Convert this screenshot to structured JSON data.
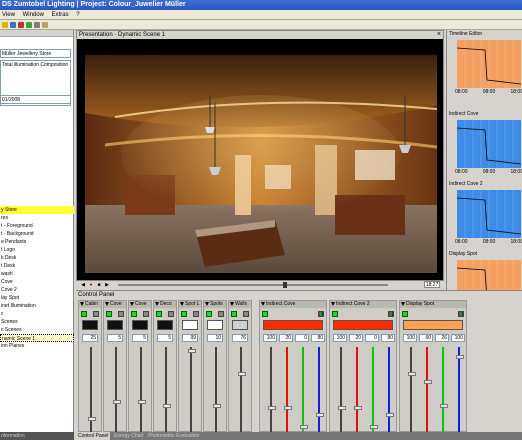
{
  "window": {
    "title": "DS Zumtobel Lighting | Project: Colour_Juwelier Müller"
  },
  "menu": [
    "View",
    "Window",
    "Extras",
    "?"
  ],
  "left_panel": {
    "store_field": "Müller Jewellery Store",
    "composition_field": "Total illumination Composition",
    "date_field": "01/2008",
    "tree_items": [
      "y Store",
      "res",
      "t - Foreground",
      "t - Background",
      "e Pendants",
      "t Logo",
      "k Desk",
      "t Desk",
      "wash",
      "Cove",
      "Cove 2",
      "lay Spot",
      "inet Illumination",
      "c",
      "Scenes",
      "c Scenes",
      "namic Scene 1",
      "ion Planes"
    ],
    "selected_items": [
      0,
      16
    ],
    "bottom_label": "nformation"
  },
  "presentation": {
    "header": "Presentation · Dynamic Scene 1",
    "close": "×",
    "timecode": "18:27",
    "progress": 0.62
  },
  "timeline": {
    "header": "Timeline Editor",
    "ticks": [
      "08:00",
      "08:00",
      "18:00"
    ],
    "tracks": [
      {
        "label": "",
        "color": "#f4a060"
      },
      {
        "label": "Indirect Cove",
        "color": "#3c8ce8"
      },
      {
        "label": "Indirect Cove 2",
        "color": "#3c8ce8"
      },
      {
        "label": "Display Spot",
        "color": "#f4a060"
      }
    ]
  },
  "control_panel": {
    "header": "Control Panel",
    "channels": [
      {
        "name": "Cabin",
        "swatch": "#111111",
        "value": "25",
        "level": 0.15
      },
      {
        "name": "Cove",
        "swatch": "#111111",
        "value": "5",
        "level": 0.35
      },
      {
        "name": "Cove",
        "swatch": "#111111",
        "value": "5",
        "level": 0.35
      },
      {
        "name": "Deco",
        "swatch": "#111111",
        "value": "5",
        "level": 0.3
      },
      {
        "name": "Spot L",
        "swatch": "#ffffff",
        "value": "99",
        "level": 0.98
      },
      {
        "name": "Spots",
        "swatch": "#ffffff",
        "value": "10",
        "level": 0.3
      },
      {
        "name": "Walls",
        "swatch": "#d0d0d0",
        "value": "76",
        "level": 0.7
      }
    ],
    "color_channels": [
      {
        "name": "Indirect Cove",
        "swatch": "#ff2a00",
        "values": [
          "100",
          "20",
          "0",
          "80"
        ],
        "levels": [
          0.28,
          0.28,
          0.05,
          0.2
        ]
      },
      {
        "name": "Indirect Cove 2",
        "swatch": "#ff2a00",
        "values": [
          "100",
          "20",
          "0",
          "80"
        ],
        "levels": [
          0.28,
          0.28,
          0.05,
          0.2
        ]
      },
      {
        "name": "Display Spot",
        "swatch": "#ffa050",
        "values": [
          "100",
          "60",
          "26",
          "100"
        ],
        "levels": [
          0.7,
          0.6,
          0.3,
          0.9
        ]
      }
    ]
  },
  "bottom_tabs": [
    "Control Panel",
    "Energy Chart",
    "Photometric Evaluation"
  ]
}
